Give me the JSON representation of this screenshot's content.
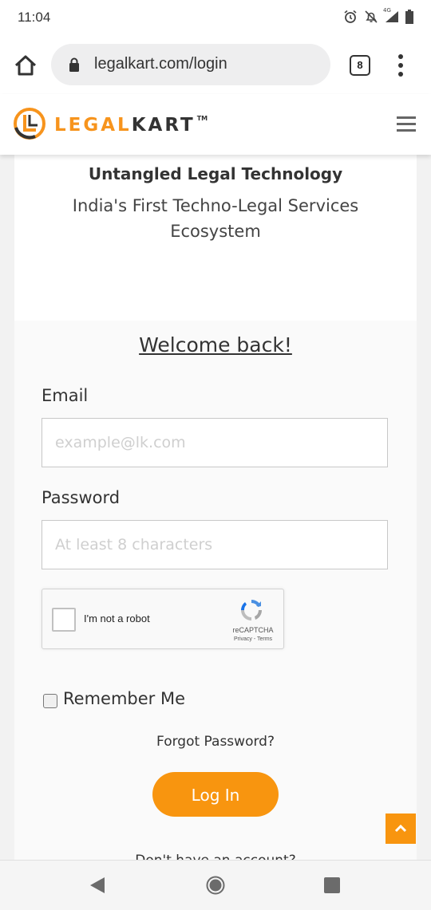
{
  "status_bar": {
    "time": "11:04",
    "network_label": "4G"
  },
  "browser": {
    "url": "legalkart.com/login",
    "tab_count": "8"
  },
  "header": {
    "logo_legal": "LEGAL",
    "logo_kart": "KART",
    "logo_tm": "TM"
  },
  "hero": {
    "tagline": "Untangled Legal Technology",
    "subtagline": "India's First Techno-Legal Services Ecosystem"
  },
  "login": {
    "welcome": "Welcome back!",
    "email_label": "Email",
    "email_placeholder": "example@lk.com",
    "password_label": "Password",
    "password_placeholder": "At least 8 characters",
    "recaptcha_label": "I'm not a robot",
    "recaptcha_brand": "reCAPTCHA",
    "recaptcha_links": "Privacy - Terms",
    "remember_label": "Remember Me",
    "forgot_label": "Forgot Password?",
    "login_button": "Log In",
    "signup_hint": "Don't have an account?"
  },
  "colors": {
    "accent": "#f8950f",
    "text": "#333333"
  }
}
